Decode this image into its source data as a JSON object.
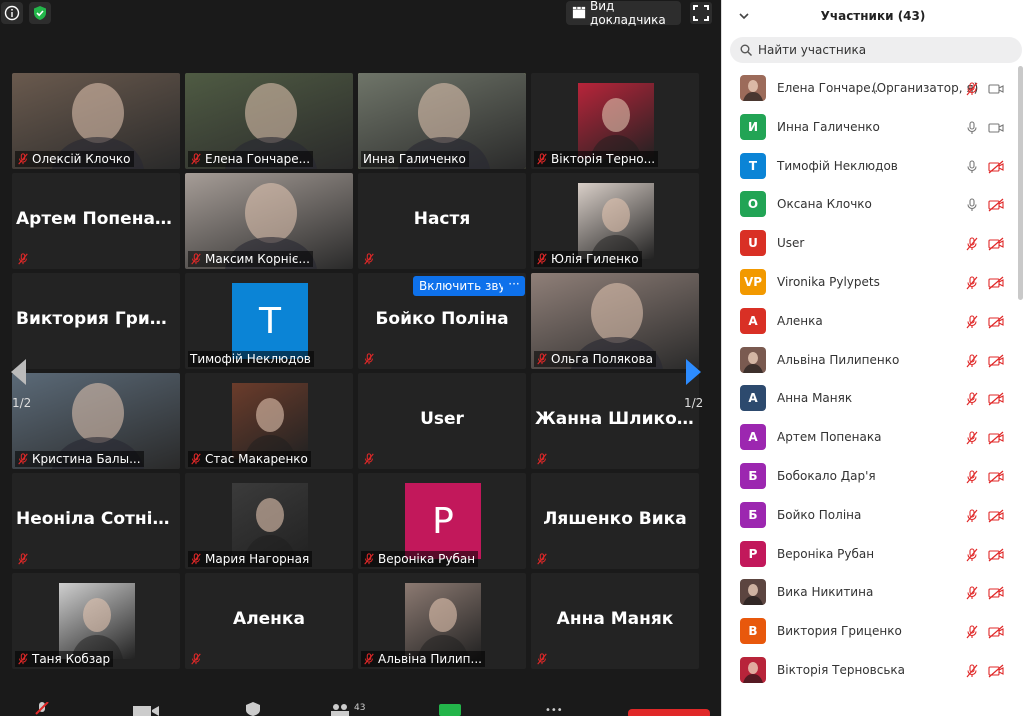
{
  "top_bar": {
    "speaker_view_label": "Вид докладчика"
  },
  "grid": {
    "page_indicator": "1/2",
    "unmute_label": "Включить звук",
    "more_label": "···",
    "tiles": [
      {
        "name": "Олексій Клочко",
        "type": "video",
        "muted": true,
        "bg": "#6a5a4e"
      },
      {
        "name": "Елена Гончаре...",
        "type": "video",
        "muted": true,
        "bg": "#4f5b43"
      },
      {
        "name": "Инна Галиченко",
        "type": "video",
        "muted": false,
        "bg": "#6f7569",
        "active": true
      },
      {
        "name": "Вікторія Терно...",
        "type": "photo",
        "muted": true,
        "bg": "#b8243a"
      },
      {
        "name": "Артем Попенака",
        "type": "name",
        "muted": true
      },
      {
        "name": "Максим Корніє...",
        "type": "video",
        "muted": true,
        "bg": "#a69d97"
      },
      {
        "name": "Настя",
        "type": "name",
        "muted": true
      },
      {
        "name": "Юлія Гиленко",
        "type": "photo",
        "muted": true,
        "bg": "#d9cfc8"
      },
      {
        "name": "Виктория Гриц...",
        "type": "name",
        "muted": false
      },
      {
        "name": "Тимофій Неклюдов",
        "type": "avatar",
        "letter": "T",
        "color": "#0b84d6",
        "muted": false
      },
      {
        "name": "Бойко Поліна",
        "type": "name",
        "muted": true,
        "hover": true
      },
      {
        "name": "Ольга Полякова",
        "type": "video",
        "muted": true,
        "bg": "#8f7f78"
      },
      {
        "name": "Кристина Балы...",
        "type": "video",
        "muted": true,
        "bg": "#5b6a78"
      },
      {
        "name": "Стас Макаренко",
        "type": "photo",
        "muted": true,
        "bg": "#6b3c2b"
      },
      {
        "name": "User",
        "type": "name",
        "muted": true
      },
      {
        "name": "Жанна Шликова",
        "type": "name",
        "muted": true
      },
      {
        "name": "Неоніла Сотнік...",
        "type": "name",
        "muted": true
      },
      {
        "name": "Мария Нагорная",
        "type": "photo",
        "muted": true,
        "bg": "#3b3b3b"
      },
      {
        "name": "Вероніка Рубан",
        "type": "avatar",
        "letter": "P",
        "color": "#c2185b",
        "muted": true
      },
      {
        "name": "Ляшенко Вика",
        "type": "name",
        "muted": true
      },
      {
        "name": "Таня Кобзар",
        "type": "photo",
        "muted": true,
        "bg": "#cfcfcf"
      },
      {
        "name": "Аленка",
        "type": "name",
        "muted": true
      },
      {
        "name": "Альвіна Пилип...",
        "type": "photo",
        "muted": true,
        "bg": "#8c7a72"
      },
      {
        "name": "Анна Маняк",
        "type": "name",
        "muted": true
      }
    ],
    "big_names": {
      "4": "Артем Попенака",
      "6": "Настя",
      "8": "Виктория Гриц...",
      "10": "Бойко Поліна",
      "14": "User",
      "15": "Жанна Шликова",
      "16": "Неоніла Сотнік...",
      "19": "Ляшенко Вика",
      "21": "Аленка",
      "23": "Анна Маняк"
    }
  },
  "toolbar": {
    "participants_count": "43"
  },
  "panel": {
    "title": "Участники (43)",
    "search_placeholder": "Найти участника",
    "participants": [
      {
        "name": "Елена Гончаре...",
        "role": "(Организатор, я)",
        "avatar": "photo",
        "color": "#9c6b5a",
        "mic": "muted",
        "cam": "on"
      },
      {
        "name": "Инна Галиченко",
        "role": "",
        "avatar": "И",
        "color": "#22a455",
        "mic": "on",
        "cam": "on"
      },
      {
        "name": "Тимофій Неклюдов",
        "role": "",
        "avatar": "T",
        "color": "#0b84d6",
        "mic": "on",
        "cam": "off"
      },
      {
        "name": "Оксана Клочко",
        "role": "",
        "avatar": "O",
        "color": "#22a455",
        "mic": "on",
        "cam": "off"
      },
      {
        "name": "User",
        "role": "",
        "avatar": "U",
        "color": "#d93025",
        "mic": "muted",
        "cam": "off"
      },
      {
        "name": "Vironika Pylypets",
        "role": "",
        "avatar": "VP",
        "color": "#f29900",
        "mic": "muted",
        "cam": "off"
      },
      {
        "name": "Аленка",
        "role": "",
        "avatar": "A",
        "color": "#d93025",
        "mic": "muted",
        "cam": "off"
      },
      {
        "name": "Альвіна Пилипенко",
        "role": "",
        "avatar": "photo",
        "color": "#7a5a50",
        "mic": "muted",
        "cam": "off"
      },
      {
        "name": "Анна Маняк",
        "role": "",
        "avatar": "A",
        "color": "#2d4a6e",
        "mic": "muted",
        "cam": "off"
      },
      {
        "name": "Артем Попенака",
        "role": "",
        "avatar": "A",
        "color": "#9c27b0",
        "mic": "muted",
        "cam": "off"
      },
      {
        "name": "Бобокало Дар'я",
        "role": "",
        "avatar": "Б",
        "color": "#9c27b0",
        "mic": "muted",
        "cam": "off"
      },
      {
        "name": "Бойко Поліна",
        "role": "",
        "avatar": "Б",
        "color": "#9c27b0",
        "mic": "muted",
        "cam": "off"
      },
      {
        "name": "Вероніка Рубан",
        "role": "",
        "avatar": "P",
        "color": "#c2185b",
        "mic": "muted",
        "cam": "off"
      },
      {
        "name": "Вика Никитина",
        "role": "",
        "avatar": "photo",
        "color": "#5c4540",
        "mic": "muted",
        "cam": "off"
      },
      {
        "name": "Виктория Гриценко",
        "role": "",
        "avatar": "B",
        "color": "#e8580c",
        "mic": "muted",
        "cam": "off"
      },
      {
        "name": "Вікторія Терновська",
        "role": "",
        "avatar": "photo",
        "color": "#b8243a",
        "mic": "muted",
        "cam": "off"
      }
    ]
  }
}
